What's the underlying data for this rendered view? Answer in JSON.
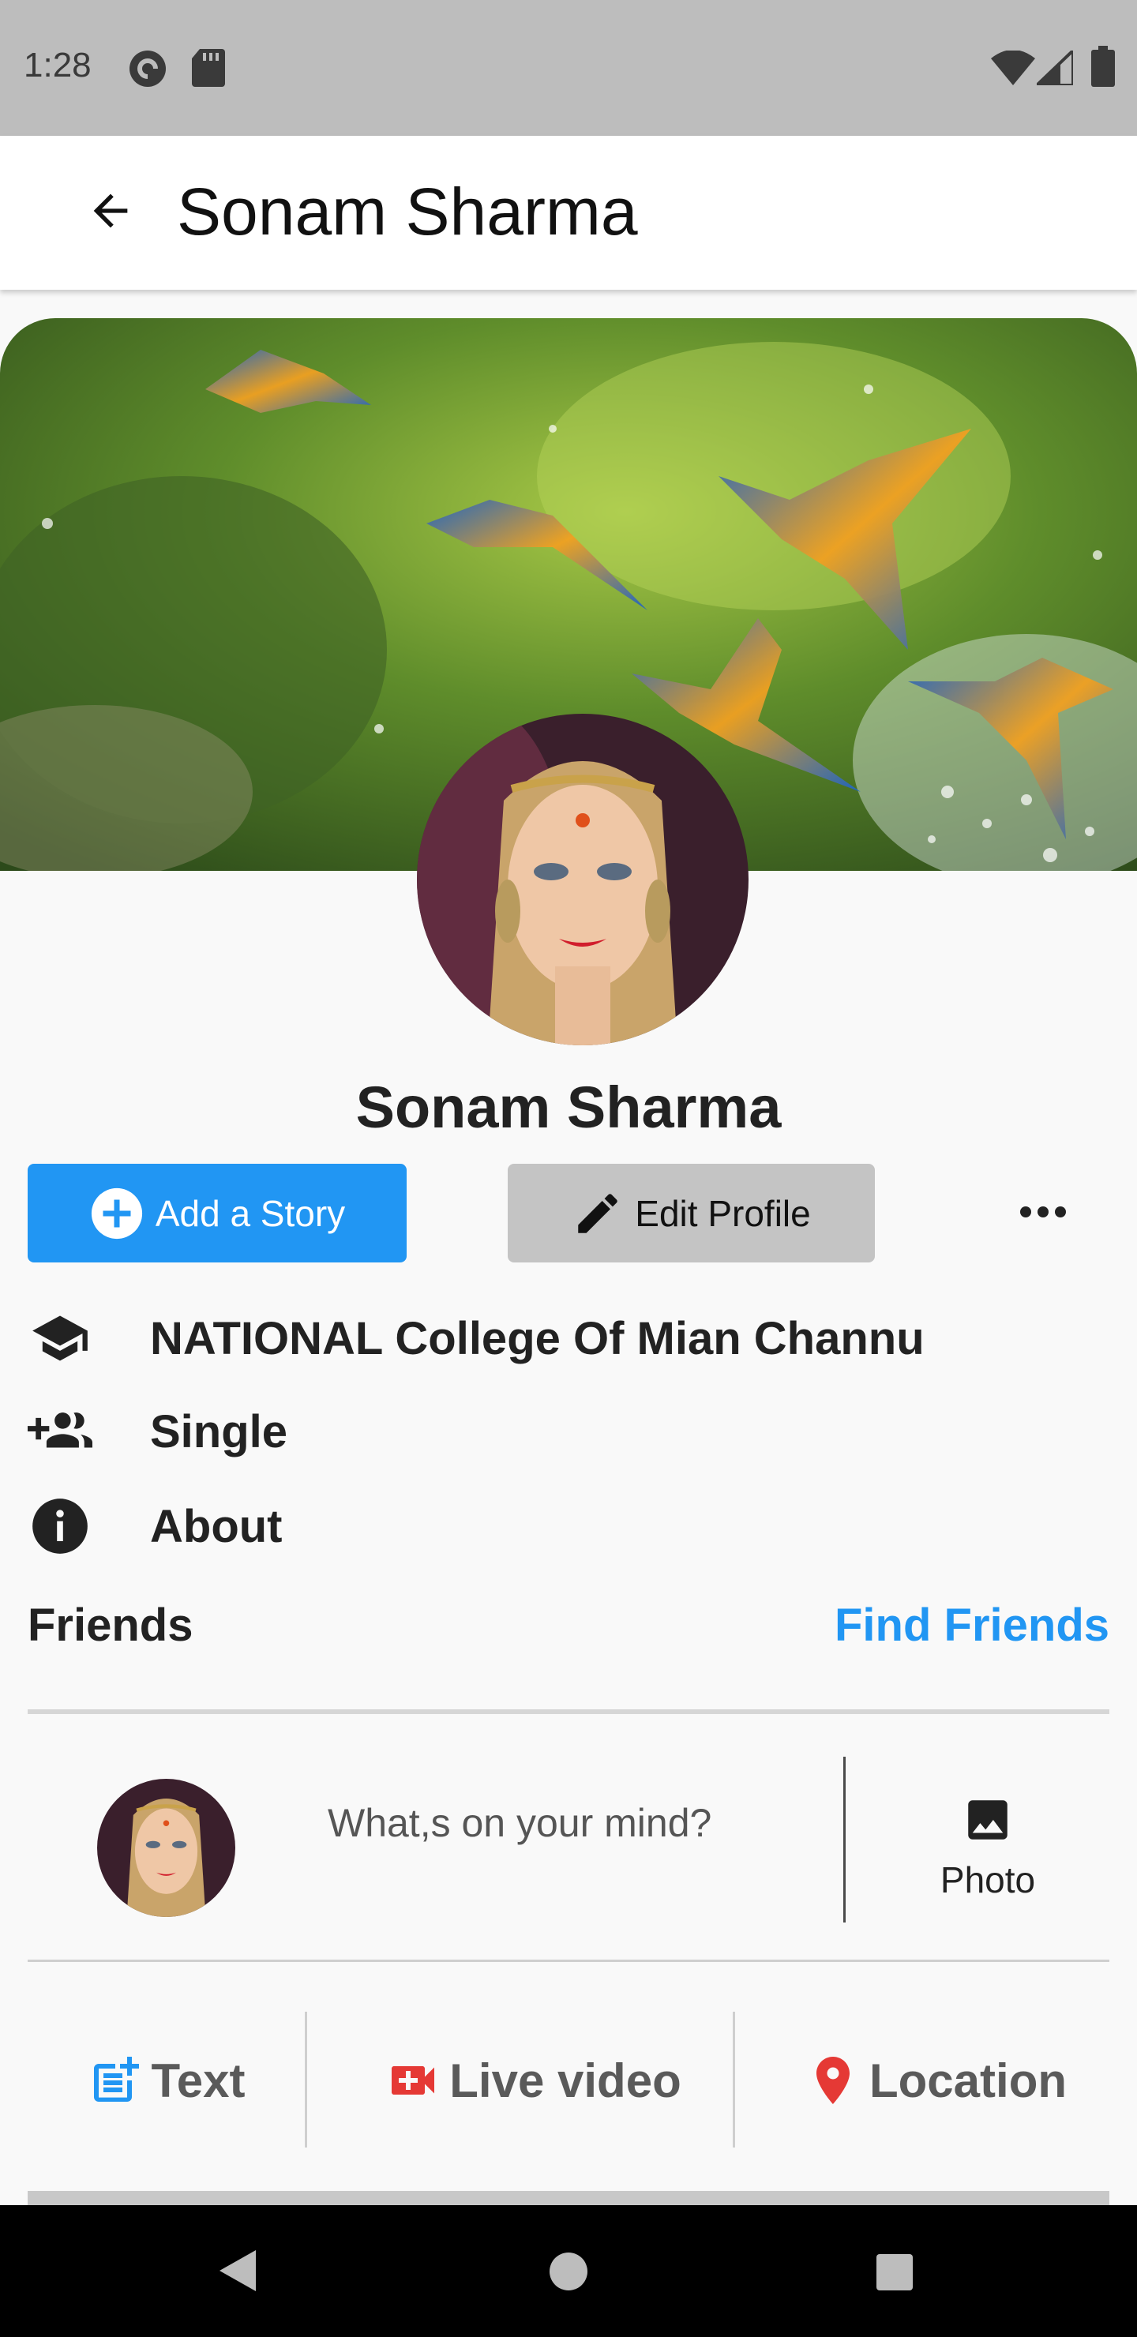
{
  "status_bar": {
    "time": "1:28",
    "icons": [
      "pocket-casts-icon",
      "sd-card-icon",
      "wifi-icon",
      "cell-signal-icon",
      "battery-icon"
    ]
  },
  "app_bar": {
    "title": "Sonam Sharma",
    "back_icon": "arrow-back-icon"
  },
  "profile": {
    "name": "Sonam Sharma",
    "add_story_label": "Add a Story",
    "edit_profile_label": "Edit Profile",
    "more_icon": "more-horizontal-icon"
  },
  "info": [
    {
      "icon": "school-icon",
      "text": "NATIONAL College Of Mian Channu"
    },
    {
      "icon": "group-add-icon",
      "text": "Single"
    },
    {
      "icon": "info-icon",
      "text": "About"
    }
  ],
  "friends": {
    "label": "Friends",
    "find_label": "Find Friends"
  },
  "composer": {
    "placeholder": "What,s on your mind?",
    "photo_label": "Photo"
  },
  "actions": [
    {
      "icon": "post-add-icon",
      "label": "Text",
      "color": "#2196f3"
    },
    {
      "icon": "video-call-icon",
      "label": "Live video",
      "color": "#e53935"
    },
    {
      "icon": "location-pin-icon",
      "label": "Location",
      "color": "#e53935"
    }
  ],
  "colors": {
    "accent": "#2196f3",
    "status_bar": "#bdbdbd",
    "nav_bar": "#000000"
  },
  "nav_bar": {
    "icons": [
      "back-triangle-icon",
      "home-circle-icon",
      "recents-square-icon"
    ]
  }
}
